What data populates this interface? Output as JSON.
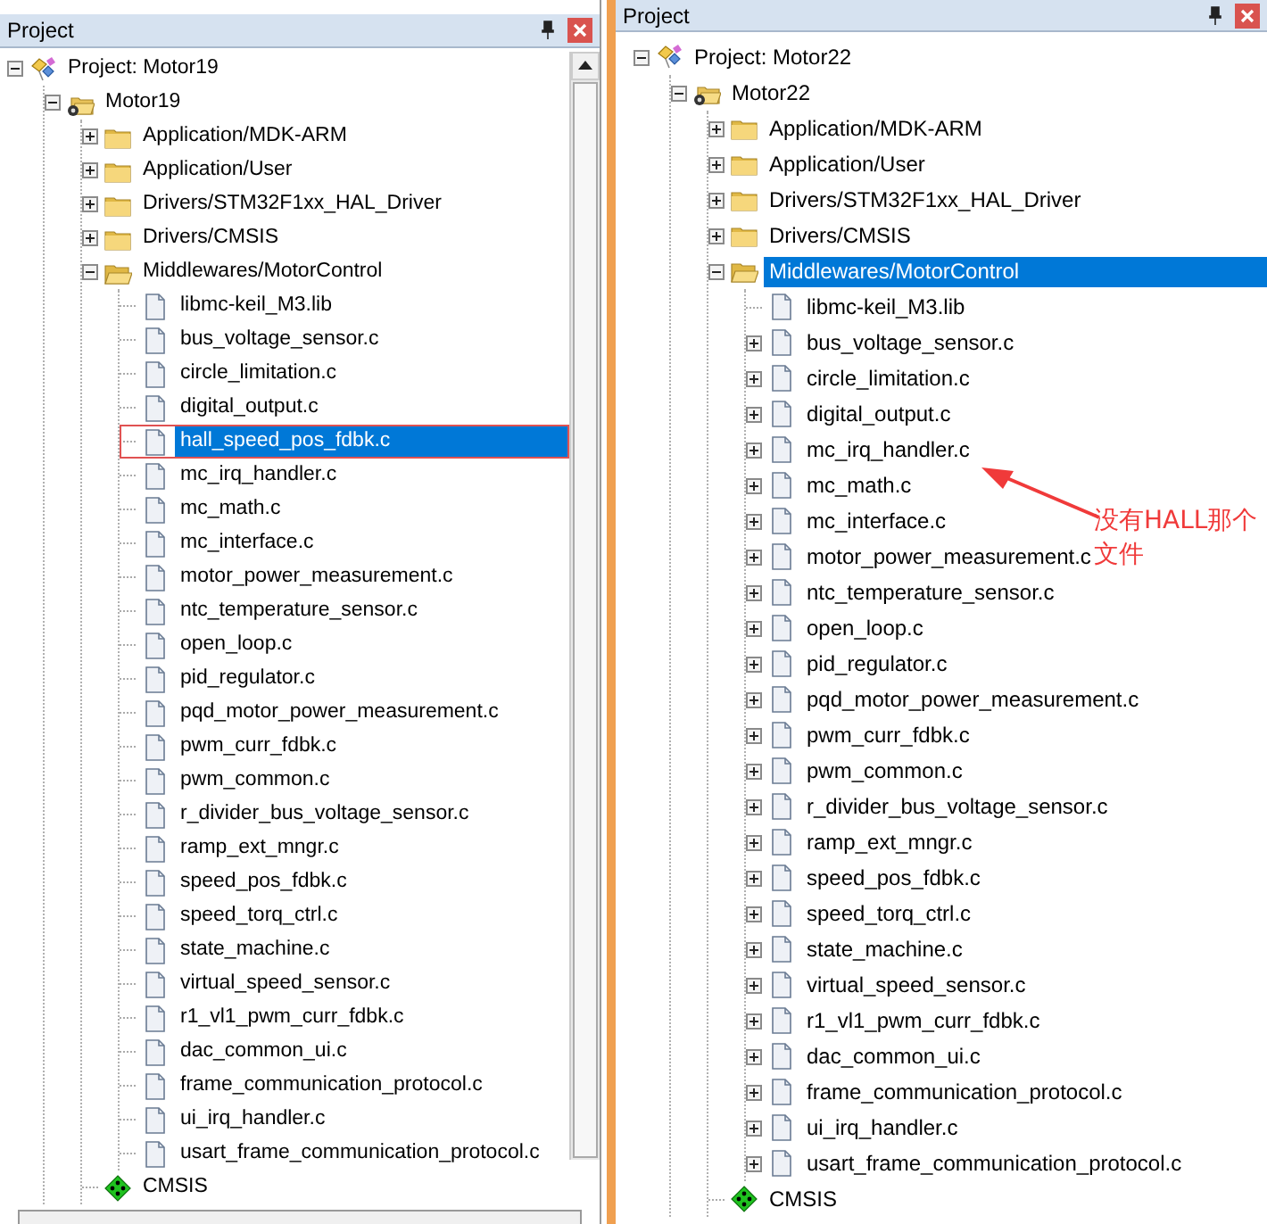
{
  "panels": [
    {
      "title": "Project",
      "tree": [
        {
          "label": "Project: Motor19",
          "kind": "project",
          "expander": true,
          "expanded": true,
          "selected": false,
          "marked": false,
          "children": [
            {
              "label": "Motor19",
              "kind": "target",
              "expander": true,
              "expanded": true,
              "selected": false,
              "marked": false,
              "children": [
                {
                  "label": "Application/MDK-ARM",
                  "kind": "group",
                  "expander": true,
                  "expanded": false,
                  "selected": false,
                  "marked": false
                },
                {
                  "label": "Application/User",
                  "kind": "group",
                  "expander": true,
                  "expanded": false,
                  "selected": false,
                  "marked": false
                },
                {
                  "label": "Drivers/STM32F1xx_HAL_Driver",
                  "kind": "group",
                  "expander": true,
                  "expanded": false,
                  "selected": false,
                  "marked": false
                },
                {
                  "label": "Drivers/CMSIS",
                  "kind": "group",
                  "expander": true,
                  "expanded": false,
                  "selected": false,
                  "marked": false
                },
                {
                  "label": "Middlewares/MotorControl",
                  "kind": "group",
                  "expander": true,
                  "expanded": true,
                  "selected": false,
                  "marked": false,
                  "children": [
                    {
                      "label": "libmc-keil_M3.lib",
                      "kind": "file",
                      "expander": false,
                      "selected": false,
                      "marked": false
                    },
                    {
                      "label": "bus_voltage_sensor.c",
                      "kind": "file",
                      "expander": false,
                      "selected": false,
                      "marked": false
                    },
                    {
                      "label": "circle_limitation.c",
                      "kind": "file",
                      "expander": false,
                      "selected": false,
                      "marked": false
                    },
                    {
                      "label": "digital_output.c",
                      "kind": "file",
                      "expander": false,
                      "selected": false,
                      "marked": false
                    },
                    {
                      "label": "hall_speed_pos_fdbk.c",
                      "kind": "file",
                      "expander": false,
                      "selected": true,
                      "marked": true
                    },
                    {
                      "label": "mc_irq_handler.c",
                      "kind": "file",
                      "expander": false,
                      "selected": false,
                      "marked": false
                    },
                    {
                      "label": "mc_math.c",
                      "kind": "file",
                      "expander": false,
                      "selected": false,
                      "marked": false
                    },
                    {
                      "label": "mc_interface.c",
                      "kind": "file",
                      "expander": false,
                      "selected": false,
                      "marked": false
                    },
                    {
                      "label": "motor_power_measurement.c",
                      "kind": "file",
                      "expander": false,
                      "selected": false,
                      "marked": false
                    },
                    {
                      "label": "ntc_temperature_sensor.c",
                      "kind": "file",
                      "expander": false,
                      "selected": false,
                      "marked": false
                    },
                    {
                      "label": "open_loop.c",
                      "kind": "file",
                      "expander": false,
                      "selected": false,
                      "marked": false
                    },
                    {
                      "label": "pid_regulator.c",
                      "kind": "file",
                      "expander": false,
                      "selected": false,
                      "marked": false
                    },
                    {
                      "label": "pqd_motor_power_measurement.c",
                      "kind": "file",
                      "expander": false,
                      "selected": false,
                      "marked": false
                    },
                    {
                      "label": "pwm_curr_fdbk.c",
                      "kind": "file",
                      "expander": false,
                      "selected": false,
                      "marked": false
                    },
                    {
                      "label": "pwm_common.c",
                      "kind": "file",
                      "expander": false,
                      "selected": false,
                      "marked": false
                    },
                    {
                      "label": "r_divider_bus_voltage_sensor.c",
                      "kind": "file",
                      "expander": false,
                      "selected": false,
                      "marked": false
                    },
                    {
                      "label": "ramp_ext_mngr.c",
                      "kind": "file",
                      "expander": false,
                      "selected": false,
                      "marked": false
                    },
                    {
                      "label": "speed_pos_fdbk.c",
                      "kind": "file",
                      "expander": false,
                      "selected": false,
                      "marked": false
                    },
                    {
                      "label": "speed_torq_ctrl.c",
                      "kind": "file",
                      "expander": false,
                      "selected": false,
                      "marked": false
                    },
                    {
                      "label": "state_machine.c",
                      "kind": "file",
                      "expander": false,
                      "selected": false,
                      "marked": false
                    },
                    {
                      "label": "virtual_speed_sensor.c",
                      "kind": "file",
                      "expander": false,
                      "selected": false,
                      "marked": false
                    },
                    {
                      "label": "r1_vl1_pwm_curr_fdbk.c",
                      "kind": "file",
                      "expander": false,
                      "selected": false,
                      "marked": false
                    },
                    {
                      "label": "dac_common_ui.c",
                      "kind": "file",
                      "expander": false,
                      "selected": false,
                      "marked": false
                    },
                    {
                      "label": "frame_communication_protocol.c",
                      "kind": "file",
                      "expander": false,
                      "selected": false,
                      "marked": false
                    },
                    {
                      "label": "ui_irq_handler.c",
                      "kind": "file",
                      "expander": false,
                      "selected": false,
                      "marked": false
                    },
                    {
                      "label": "usart_frame_communication_protocol.c",
                      "kind": "file",
                      "expander": false,
                      "selected": false,
                      "marked": false
                    }
                  ]
                },
                {
                  "label": "CMSIS",
                  "kind": "component",
                  "expander": false,
                  "selected": false,
                  "marked": false
                }
              ]
            }
          ]
        }
      ]
    },
    {
      "title": "Project",
      "tree": [
        {
          "label": "Project: Motor22",
          "kind": "project",
          "expander": true,
          "expanded": true,
          "selected": false,
          "marked": false,
          "children": [
            {
              "label": "Motor22",
              "kind": "target",
              "expander": true,
              "expanded": true,
              "selected": false,
              "marked": false,
              "children": [
                {
                  "label": "Application/MDK-ARM",
                  "kind": "group",
                  "expander": true,
                  "expanded": false,
                  "selected": false,
                  "marked": false
                },
                {
                  "label": "Application/User",
                  "kind": "group",
                  "expander": true,
                  "expanded": false,
                  "selected": false,
                  "marked": false
                },
                {
                  "label": "Drivers/STM32F1xx_HAL_Driver",
                  "kind": "group",
                  "expander": true,
                  "expanded": false,
                  "selected": false,
                  "marked": false
                },
                {
                  "label": "Drivers/CMSIS",
                  "kind": "group",
                  "expander": true,
                  "expanded": false,
                  "selected": false,
                  "marked": false
                },
                {
                  "label": "Middlewares/MotorControl",
                  "kind": "group",
                  "expander": true,
                  "expanded": true,
                  "selected": true,
                  "marked": false,
                  "children": [
                    {
                      "label": "libmc-keil_M3.lib",
                      "kind": "file",
                      "expander": false,
                      "selected": false,
                      "marked": false
                    },
                    {
                      "label": "bus_voltage_sensor.c",
                      "kind": "file",
                      "expander": true,
                      "expanded": false,
                      "selected": false,
                      "marked": false
                    },
                    {
                      "label": "circle_limitation.c",
                      "kind": "file",
                      "expander": true,
                      "expanded": false,
                      "selected": false,
                      "marked": false
                    },
                    {
                      "label": "digital_output.c",
                      "kind": "file",
                      "expander": true,
                      "expanded": false,
                      "selected": false,
                      "marked": false
                    },
                    {
                      "label": "mc_irq_handler.c",
                      "kind": "file",
                      "expander": true,
                      "expanded": false,
                      "selected": false,
                      "marked": false
                    },
                    {
                      "label": "mc_math.c",
                      "kind": "file",
                      "expander": true,
                      "expanded": false,
                      "selected": false,
                      "marked": false
                    },
                    {
                      "label": "mc_interface.c",
                      "kind": "file",
                      "expander": true,
                      "expanded": false,
                      "selected": false,
                      "marked": false
                    },
                    {
                      "label": "motor_power_measurement.c",
                      "kind": "file",
                      "expander": true,
                      "expanded": false,
                      "selected": false,
                      "marked": false
                    },
                    {
                      "label": "ntc_temperature_sensor.c",
                      "kind": "file",
                      "expander": true,
                      "expanded": false,
                      "selected": false,
                      "marked": false
                    },
                    {
                      "label": "open_loop.c",
                      "kind": "file",
                      "expander": true,
                      "expanded": false,
                      "selected": false,
                      "marked": false
                    },
                    {
                      "label": "pid_regulator.c",
                      "kind": "file",
                      "expander": true,
                      "expanded": false,
                      "selected": false,
                      "marked": false
                    },
                    {
                      "label": "pqd_motor_power_measurement.c",
                      "kind": "file",
                      "expander": true,
                      "expanded": false,
                      "selected": false,
                      "marked": false
                    },
                    {
                      "label": "pwm_curr_fdbk.c",
                      "kind": "file",
                      "expander": true,
                      "expanded": false,
                      "selected": false,
                      "marked": false
                    },
                    {
                      "label": "pwm_common.c",
                      "kind": "file",
                      "expander": true,
                      "expanded": false,
                      "selected": false,
                      "marked": false
                    },
                    {
                      "label": "r_divider_bus_voltage_sensor.c",
                      "kind": "file",
                      "expander": true,
                      "expanded": false,
                      "selected": false,
                      "marked": false
                    },
                    {
                      "label": "ramp_ext_mngr.c",
                      "kind": "file",
                      "expander": true,
                      "expanded": false,
                      "selected": false,
                      "marked": false
                    },
                    {
                      "label": "speed_pos_fdbk.c",
                      "kind": "file",
                      "expander": true,
                      "expanded": false,
                      "selected": false,
                      "marked": false
                    },
                    {
                      "label": "speed_torq_ctrl.c",
                      "kind": "file",
                      "expander": true,
                      "expanded": false,
                      "selected": false,
                      "marked": false
                    },
                    {
                      "label": "state_machine.c",
                      "kind": "file",
                      "expander": true,
                      "expanded": false,
                      "selected": false,
                      "marked": false
                    },
                    {
                      "label": "virtual_speed_sensor.c",
                      "kind": "file",
                      "expander": true,
                      "expanded": false,
                      "selected": false,
                      "marked": false
                    },
                    {
                      "label": "r1_vl1_pwm_curr_fdbk.c",
                      "kind": "file",
                      "expander": true,
                      "expanded": false,
                      "selected": false,
                      "marked": false
                    },
                    {
                      "label": "dac_common_ui.c",
                      "kind": "file",
                      "expander": true,
                      "expanded": false,
                      "selected": false,
                      "marked": false
                    },
                    {
                      "label": "frame_communication_protocol.c",
                      "kind": "file",
                      "expander": true,
                      "expanded": false,
                      "selected": false,
                      "marked": false
                    },
                    {
                      "label": "ui_irq_handler.c",
                      "kind": "file",
                      "expander": true,
                      "expanded": false,
                      "selected": false,
                      "marked": false
                    },
                    {
                      "label": "usart_frame_communication_protocol.c",
                      "kind": "file",
                      "expander": true,
                      "expanded": false,
                      "selected": false,
                      "marked": false
                    }
                  ]
                },
                {
                  "label": "CMSIS",
                  "kind": "component",
                  "expander": false,
                  "selected": false,
                  "marked": false
                }
              ]
            }
          ]
        }
      ]
    }
  ],
  "note": {
    "lines": [
      "没有HALL那个",
      "文件"
    ]
  }
}
